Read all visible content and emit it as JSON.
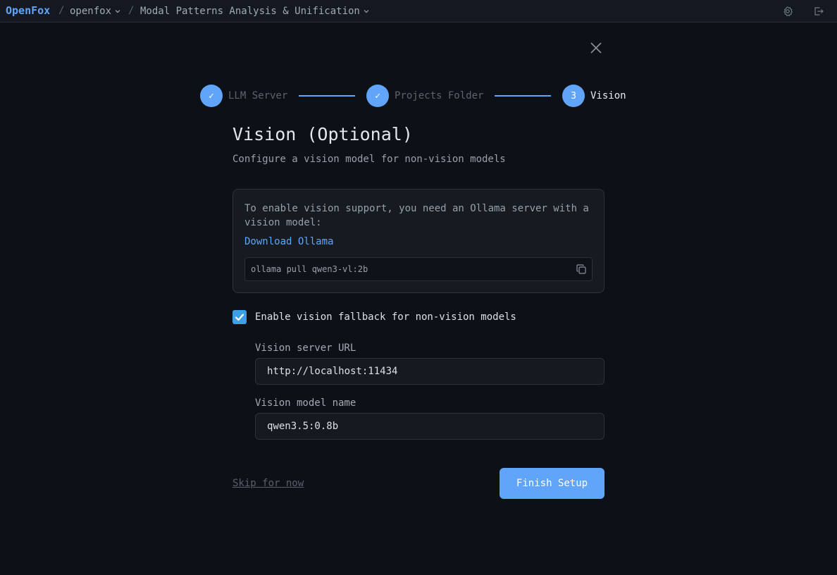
{
  "header": {
    "brand": "OpenFox",
    "separator": "/",
    "project": "openfox",
    "session": "Modal Patterns Analysis & Unification",
    "icons": [
      "gear-icon",
      "logout-icon"
    ]
  },
  "wizard": {
    "steps": [
      {
        "label": "LLM Server",
        "status": "done",
        "marker": "✓"
      },
      {
        "label": "Projects Folder",
        "status": "done",
        "marker": "✓"
      },
      {
        "label": "Vision",
        "status": "active",
        "marker": "3"
      }
    ],
    "title": "Vision (Optional)",
    "subtitle": "Configure a vision model for non-vision models",
    "info": {
      "text": "To enable vision support, you need an Ollama server with a vision model:",
      "link": "Download Ollama",
      "command": "ollama pull qwen3-vl:2b"
    },
    "fallback": {
      "label": "Enable vision fallback for non-vision models",
      "checked": true
    },
    "server_url": {
      "label": "Vision server URL",
      "value": "http://localhost:11434"
    },
    "model_name": {
      "label": "Vision model name",
      "value": "qwen3.5:0.8b"
    },
    "skip_label": "Skip for now",
    "finish_label": "Finish Setup"
  },
  "colors": {
    "accent": "#60a5fa",
    "background": "#0d1017",
    "checkbox": "#3ba0e6"
  }
}
